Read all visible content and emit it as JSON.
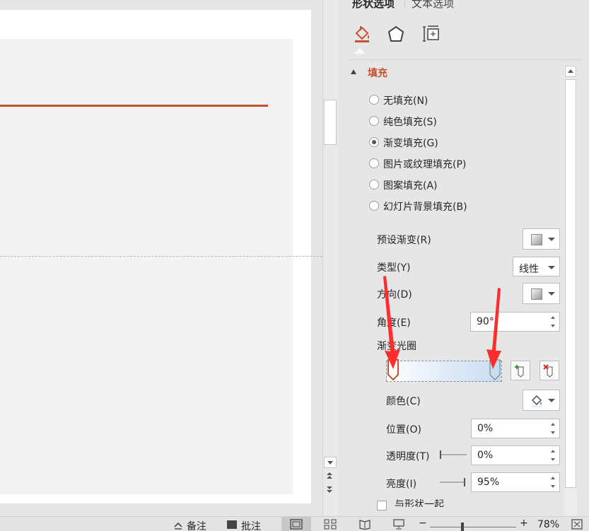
{
  "format_pane": {
    "tabs": [
      {
        "label": "形状选项",
        "active": true
      },
      {
        "label": "文本选项",
        "active": false
      }
    ],
    "category_icons": [
      "fill-and-line-icon",
      "effects-icon",
      "size-and-properties-icon"
    ],
    "section_title": "填充",
    "fill_options": [
      {
        "label": "无填充(N)",
        "checked": false
      },
      {
        "label": "纯色填充(S)",
        "checked": false
      },
      {
        "label": "渐变填充(G)",
        "checked": true
      },
      {
        "label": "图片或纹理填充(P)",
        "checked": false
      },
      {
        "label": "图案填充(A)",
        "checked": false
      },
      {
        "label": "幻灯片背景填充(B)",
        "checked": false
      }
    ],
    "preset_gradient_label": "预设渐变(R)",
    "type_label": "类型(Y)",
    "type_value": "线性",
    "direction_label": "方向(D)",
    "angle_label": "角度(E)",
    "angle_value": "90°",
    "gradient_stops_label": "渐变光圈",
    "color_label": "颜色(C)",
    "position_label": "位置(O)",
    "position_value": "0%",
    "transparency_label": "透明度(T)",
    "transparency_value": "0%",
    "brightness_label": "亮度(I)",
    "brightness_value": "95%",
    "next_option_label": "与形状一起"
  },
  "status_bar": {
    "notes_label": "备注",
    "comments_label": "批注",
    "zoom_minus": "−",
    "zoom_plus": "+",
    "zoom_value": "78%"
  },
  "colors": {
    "accent": "#c4502f",
    "arrow": "#ff2d2d",
    "gradient_start": "#ffffff",
    "gradient_end": "#c9dcf3"
  }
}
